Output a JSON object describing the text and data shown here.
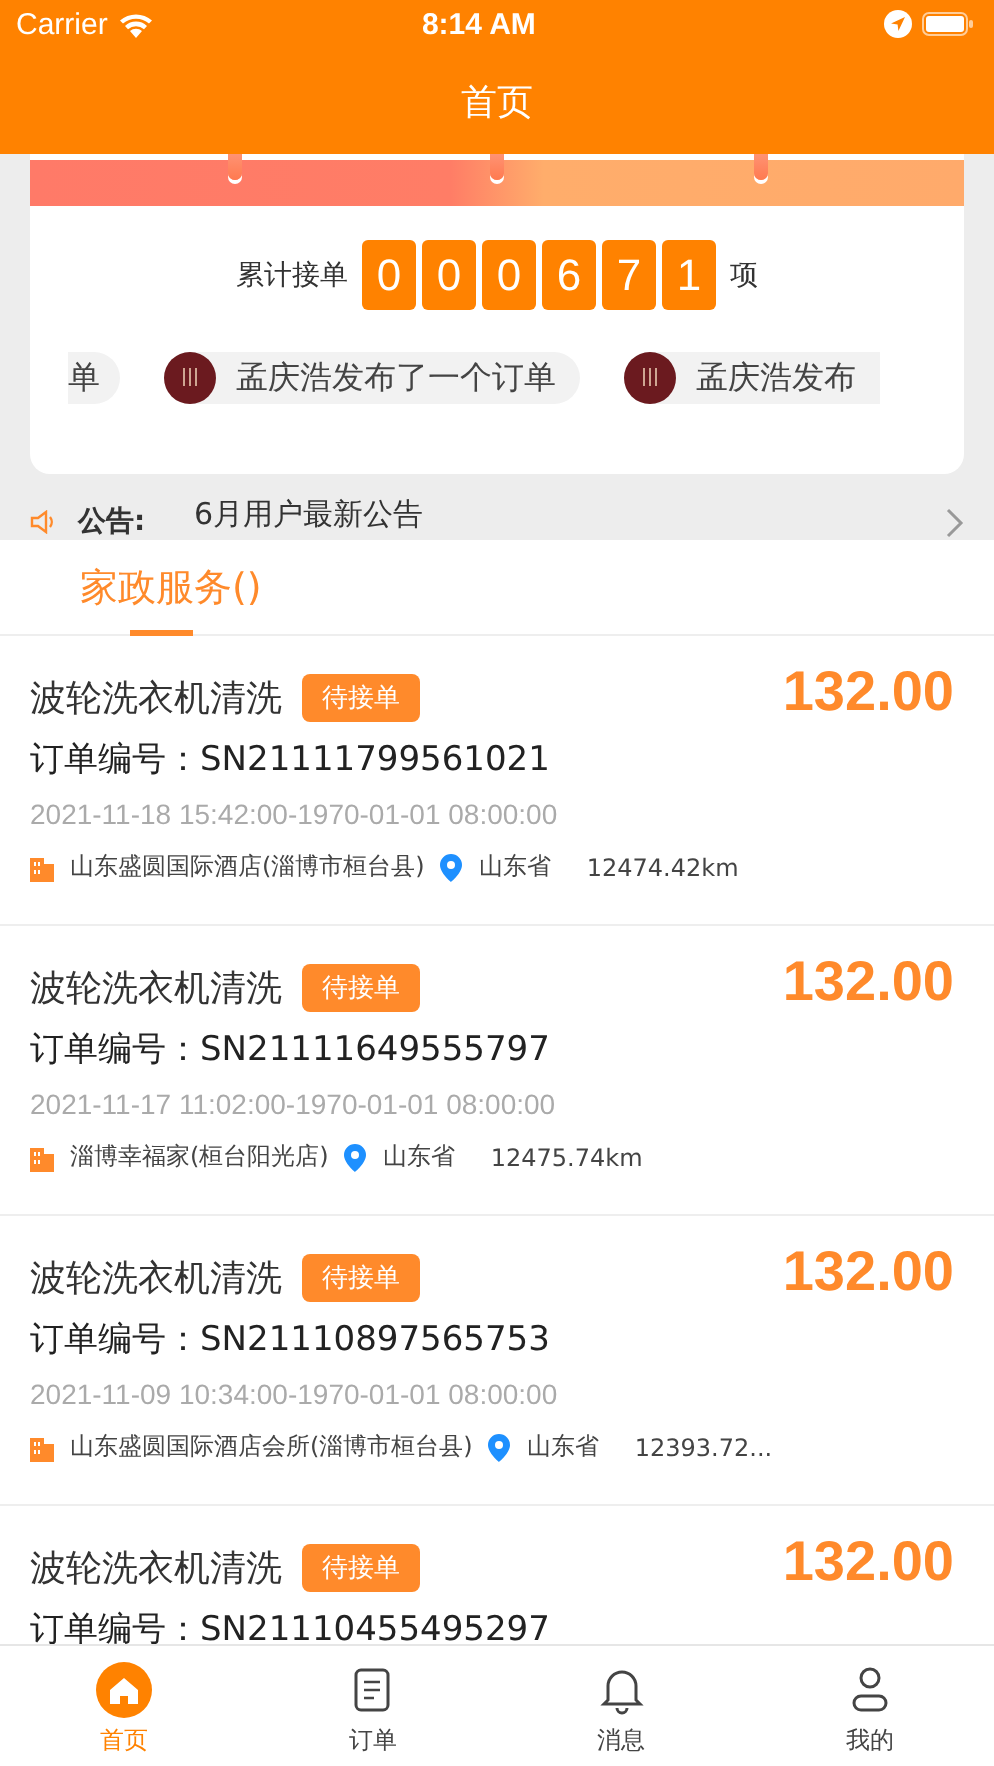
{
  "status_bar": {
    "carrier": "Carrier",
    "time": "8:14 AM"
  },
  "nav": {
    "title": "首页"
  },
  "counter": {
    "label": "累计接单",
    "digits": [
      "0",
      "0",
      "0",
      "6",
      "7",
      "1"
    ],
    "unit": "项"
  },
  "ticker": [
    {
      "text": "单",
      "kind": "tail"
    },
    {
      "text": "孟庆浩发布了一个订单",
      "kind": "full"
    },
    {
      "text": "孟庆浩发布",
      "kind": "head"
    }
  ],
  "notice": {
    "label": "公告:",
    "text": "6月用户最新公告"
  },
  "section_tab": {
    "label": "家政服务()",
    "selected": true
  },
  "orders": [
    {
      "title": "波轮洗衣机清洗",
      "status": "待接单",
      "price": "132.00",
      "order_no": "订单编号：SN21111799561021",
      "time": "2021-11-18 15:42:00-1970-01-01 08:00:00",
      "shop": "山东盛圆国际酒店(淄博市桓台县)",
      "province": "山东省",
      "distance": "12474.42km"
    },
    {
      "title": "波轮洗衣机清洗",
      "status": "待接单",
      "price": "132.00",
      "order_no": "订单编号：SN21111649555797",
      "time": "2021-11-17 11:02:00-1970-01-01 08:00:00",
      "shop": "淄博幸福家(桓台阳光店)",
      "province": "山东省",
      "distance": "12475.74km"
    },
    {
      "title": "波轮洗衣机清洗",
      "status": "待接单",
      "price": "132.00",
      "order_no": "订单编号：SN21110897565753",
      "time": "2021-11-09 10:34:00-1970-01-01 08:00:00",
      "shop": "山东盛圆国际酒店会所(淄博市桓台县)",
      "province": "山东省",
      "distance": "12393.72..."
    },
    {
      "title": "波轮洗衣机清洗",
      "status": "待接单",
      "price": "132.00",
      "order_no": "订单编号：SN21110455495297"
    }
  ],
  "tabbar": [
    {
      "label": "首页",
      "kind": "home",
      "selected": true
    },
    {
      "label": "订单",
      "kind": "orders",
      "selected": false
    },
    {
      "label": "消息",
      "kind": "messages",
      "selected": false
    },
    {
      "label": "我的",
      "kind": "profile",
      "selected": false
    }
  ]
}
